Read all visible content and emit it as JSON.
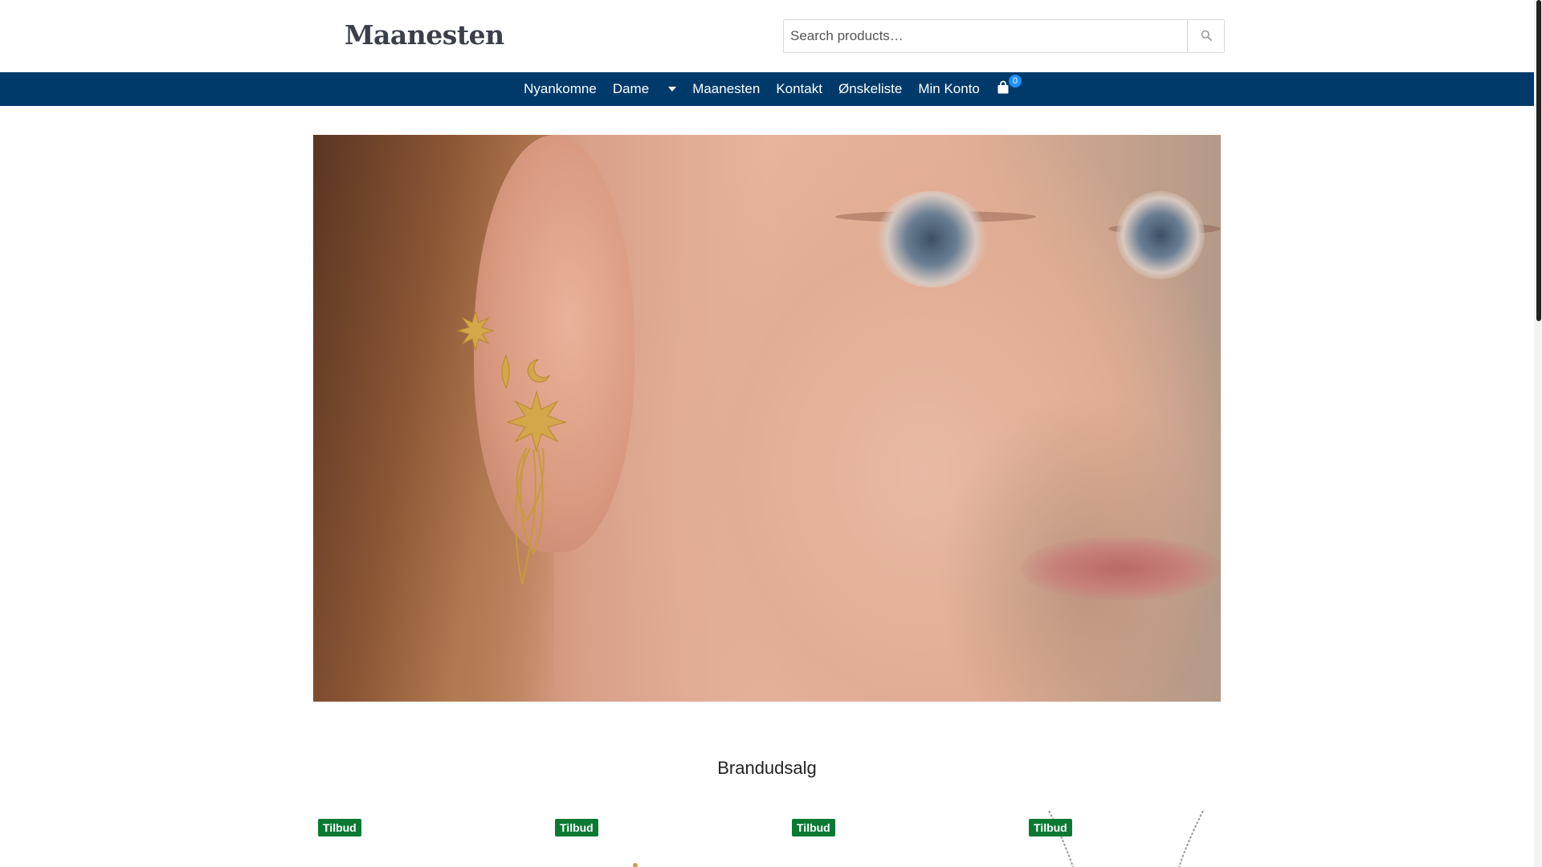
{
  "header": {
    "logo_text": "Maanesten",
    "search": {
      "placeholder": "Search products…",
      "icon": "search-icon"
    }
  },
  "nav": {
    "items": [
      {
        "label": "Nyankomne"
      },
      {
        "label": "Dame",
        "has_dropdown": true
      },
      {
        "label": "Maanesten"
      },
      {
        "label": "Kontakt"
      },
      {
        "label": "Ønskeliste"
      },
      {
        "label": "Min Konto"
      }
    ],
    "cart": {
      "icon": "shopping-bag-icon",
      "count": "0"
    },
    "background_color": "#003a6b"
  },
  "hero": {
    "image": "woman-profile-gold-earrings"
  },
  "section": {
    "title": "Brandudsalg",
    "products": [
      {
        "badge": "Tilbud"
      },
      {
        "badge": "Tilbud"
      },
      {
        "badge": "Tilbud"
      },
      {
        "badge": "Tilbud"
      }
    ],
    "badge_color": "#0a7a33"
  }
}
